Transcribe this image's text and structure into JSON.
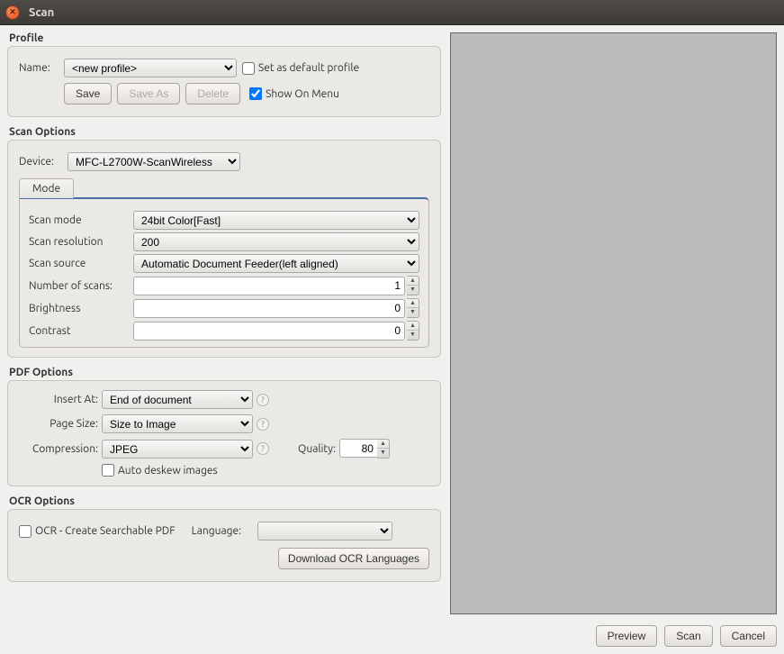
{
  "window": {
    "title": "Scan"
  },
  "profile": {
    "section_label": "Profile",
    "name_label": "Name:",
    "name_value": "<new profile>",
    "set_default_label": "Set as default profile",
    "save_label": "Save",
    "save_as_label": "Save As",
    "delete_label": "Delete",
    "show_on_menu_label": "Show On Menu"
  },
  "scan_options": {
    "section_label": "Scan Options",
    "device_label": "Device:",
    "device_value": "MFC-L2700W-ScanWireless",
    "tab_mode_label": "Mode",
    "scan_mode_label": "Scan mode",
    "scan_mode_value": "24bit Color[Fast]",
    "scan_resolution_label": "Scan resolution",
    "scan_resolution_value": "200",
    "scan_source_label": "Scan source",
    "scan_source_value": "Automatic Document Feeder(left aligned)",
    "number_of_scans_label": "Number of scans:",
    "number_of_scans_value": "1",
    "brightness_label": "Brightness",
    "brightness_value": "0",
    "contrast_label": "Contrast",
    "contrast_value": "0"
  },
  "pdf_options": {
    "section_label": "PDF Options",
    "insert_at_label": "Insert At:",
    "insert_at_value": "End of document",
    "page_size_label": "Page Size:",
    "page_size_value": "Size to Image",
    "compression_label": "Compression:",
    "compression_value": "JPEG",
    "quality_label": "Quality:",
    "quality_value": "80",
    "auto_deskew_label": "Auto deskew images"
  },
  "ocr_options": {
    "section_label": "OCR Options",
    "ocr_checkbox_label": "OCR - Create Searchable PDF",
    "language_label": "Language:",
    "download_label": "Download OCR Languages"
  },
  "footer": {
    "preview_label": "Preview",
    "scan_label": "Scan",
    "cancel_label": "Cancel"
  }
}
